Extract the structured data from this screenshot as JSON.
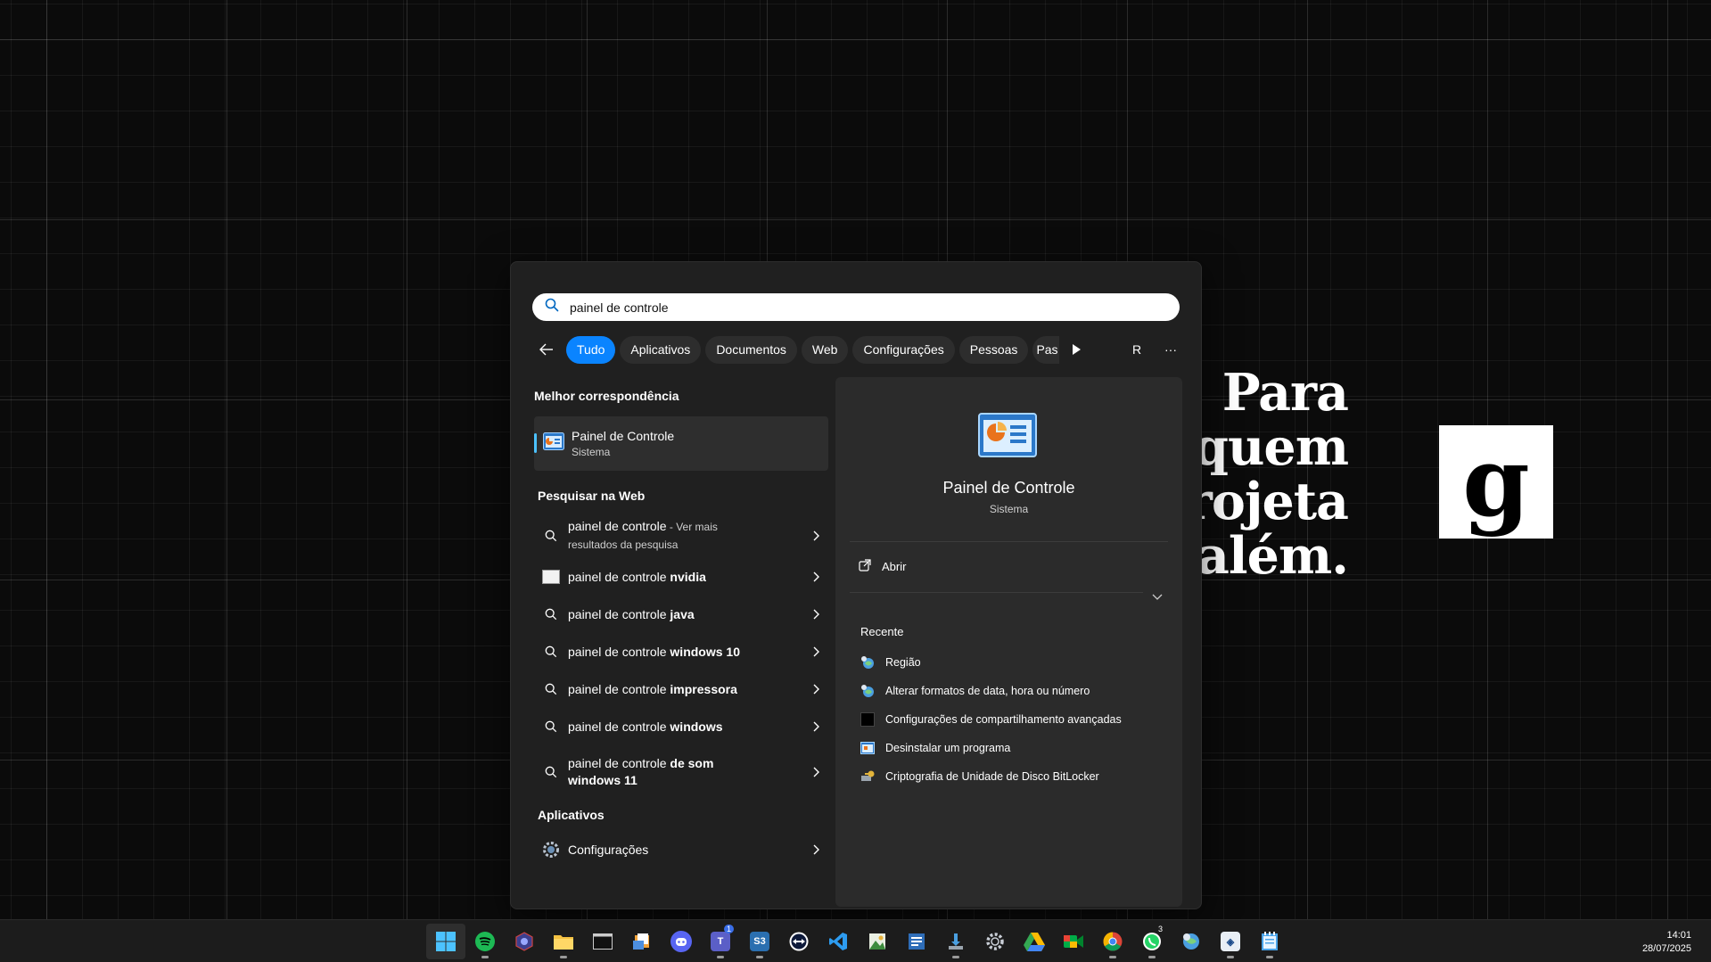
{
  "wallpaper": {
    "lines": [
      "Para",
      "quem",
      "projeta",
      "além."
    ],
    "logo_letter": "g"
  },
  "search": {
    "value": "painel de controle",
    "placeholder": ""
  },
  "filters": {
    "items": [
      "Tudo",
      "Aplicativos",
      "Documentos",
      "Web",
      "Configurações",
      "Pessoas",
      "Pas"
    ],
    "active": "Tudo",
    "avatar_letter": "R",
    "more": "···"
  },
  "best_match": {
    "heading": "Melhor correspondência",
    "name": "Painel de Controle",
    "type": "Sistema"
  },
  "web": {
    "heading": "Pesquisar na Web",
    "first": {
      "query": "painel de controle",
      "suffix": " - Ver mais",
      "sub": "resultados da pesquisa"
    },
    "items": [
      {
        "prefix": "painel de controle ",
        "bold": "nvidia",
        "icon": "nvidia-icon"
      },
      {
        "prefix": "painel de controle ",
        "bold": "java",
        "icon": "search-icon"
      },
      {
        "prefix": "painel de controle ",
        "bold": "windows 10",
        "icon": "search-icon"
      },
      {
        "prefix": "painel de controle ",
        "bold": "impressora",
        "icon": "search-icon"
      },
      {
        "prefix": "painel de controle ",
        "bold": "windows",
        "icon": "search-icon"
      }
    ],
    "last": {
      "prefix": "painel de controle ",
      "bold": "de som",
      "bold2": "windows 11"
    }
  },
  "apps": {
    "heading": "Aplicativos",
    "items": [
      {
        "name": "Configurações",
        "icon": "settings-gear-icon"
      }
    ]
  },
  "detail": {
    "name": "Painel de Controle",
    "type": "Sistema",
    "open_label": "Abrir",
    "recent_heading": "Recente",
    "recent": [
      {
        "label": "Região",
        "icon": "region-globe-icon"
      },
      {
        "label": "Alterar formatos de data, hora ou número",
        "icon": "region-globe-icon"
      },
      {
        "label": "Configurações de compartilhamento avançadas",
        "icon": "network-sharing-icon"
      },
      {
        "label": "Desinstalar um programa",
        "icon": "programs-icon"
      },
      {
        "label": "Criptografia de Unidade de Disco BitLocker",
        "icon": "bitlocker-key-icon"
      }
    ]
  },
  "taskbar": {
    "clock_time": "14:01",
    "clock_date": "28/07/2025",
    "badges": {
      "teams": "1",
      "whatsapp": "3"
    },
    "sq_labels": {
      "s3": "S3"
    },
    "colors": {
      "accent": "#0a84ff",
      "spotify": "#1db954",
      "vscode": "#2d9cf0",
      "discord": "#5865f2"
    }
  }
}
